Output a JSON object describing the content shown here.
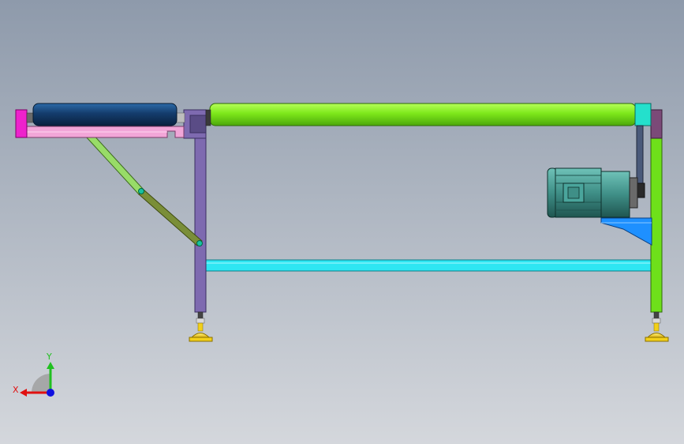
{
  "viewport": {
    "background_top": "#8e9aab",
    "background_bottom": "#d4d7dc"
  },
  "triad": {
    "x_label": "X",
    "y_label": "Y",
    "x_color": "#e01010",
    "y_color": "#20c020",
    "z_color": "#1010e0"
  },
  "colors": {
    "rollers_green": "#7de81a",
    "roller_blue": "#143c6c",
    "pink_frame": "#f2a6d8",
    "magenta_end": "#ee22cc",
    "purple_leg": "#7e6ab0",
    "green_leg": "#6ee01a",
    "cyan_beam": "#2ee6f2",
    "motor_teal": "#3f8f87",
    "bracket_blue": "#1e90ff",
    "foot_yellow": "#f2d01a",
    "brace_green": "#98dc68"
  }
}
